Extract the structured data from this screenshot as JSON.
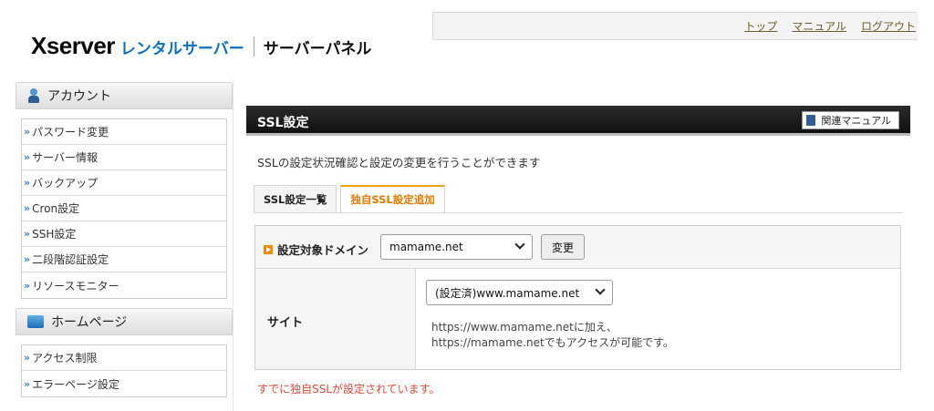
{
  "header": {
    "logo_main": "Xserver",
    "logo_sub": "レンタルサーバー",
    "logo_panel": "サーバーパネル",
    "nav": [
      "トップ",
      "マニュアル",
      "ログアウト"
    ]
  },
  "sidebar": {
    "account": {
      "title": "アカウント",
      "items": [
        "パスワード変更",
        "サーバー情報",
        "バックアップ",
        "Cron設定",
        "SSH設定",
        "二段階認証設定",
        "リソースモニター"
      ]
    },
    "homepage": {
      "title": "ホームページ",
      "items": [
        "アクセス制限",
        "エラーページ設定"
      ]
    }
  },
  "main": {
    "title": "SSL設定",
    "manual_label": "関連マニュアル",
    "description": "SSLの設定状況確認と設定の変更を行うことができます",
    "tabs": [
      "SSL設定一覧",
      "独自SSL設定追加"
    ],
    "active_tab": 1,
    "domain_label": "設定対象ドメイン",
    "domain_value": "mamame.net",
    "change_label": "変更",
    "site_label": "サイト",
    "site_value": "(設定済)www.mamame.net",
    "site_desc_line1": "https://www.mamame.netに加え、",
    "site_desc_line2": "https://mamame.netでもアクセスが可能です。",
    "status_message": "すでに独自SSLが設定されています。"
  },
  "colors": {
    "logo_blue": "#0b6fc4",
    "active_tab": "#e07a00",
    "status_red": "#e04a3a"
  }
}
